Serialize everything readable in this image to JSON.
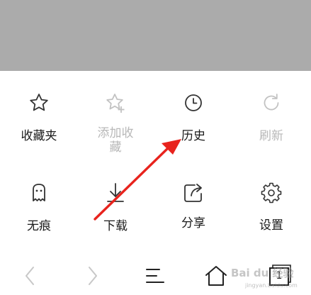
{
  "menu": {
    "row1": [
      {
        "label": "收藏夹",
        "icon": "star-icon",
        "enabled": true
      },
      {
        "label": "添加收\n藏",
        "icon": "star-plus-icon",
        "enabled": false
      },
      {
        "label": "历史",
        "icon": "clock-icon",
        "enabled": true
      },
      {
        "label": "刷新",
        "icon": "refresh-icon",
        "enabled": false
      }
    ],
    "row2": [
      {
        "label": "无痕",
        "icon": "ghost-icon",
        "enabled": true
      },
      {
        "label": "下载",
        "icon": "download-icon",
        "enabled": true
      },
      {
        "label": "分享",
        "icon": "share-icon",
        "enabled": true
      },
      {
        "label": "设置",
        "icon": "gear-icon",
        "enabled": true
      }
    ]
  },
  "nav": {
    "back_icon": "chevron-left-icon",
    "forward_icon": "chevron-right-icon",
    "menu_icon": "menu-icon",
    "home_icon": "home-icon",
    "tabs_count": "1"
  },
  "watermark": {
    "text": "Bai du 经验",
    "sub": "jingyan.baidu.com"
  },
  "colors": {
    "overlay": "#ababab",
    "text": "#1a1a1a",
    "disabled_text": "#b8b8b8",
    "arrow": "#e8231d"
  }
}
